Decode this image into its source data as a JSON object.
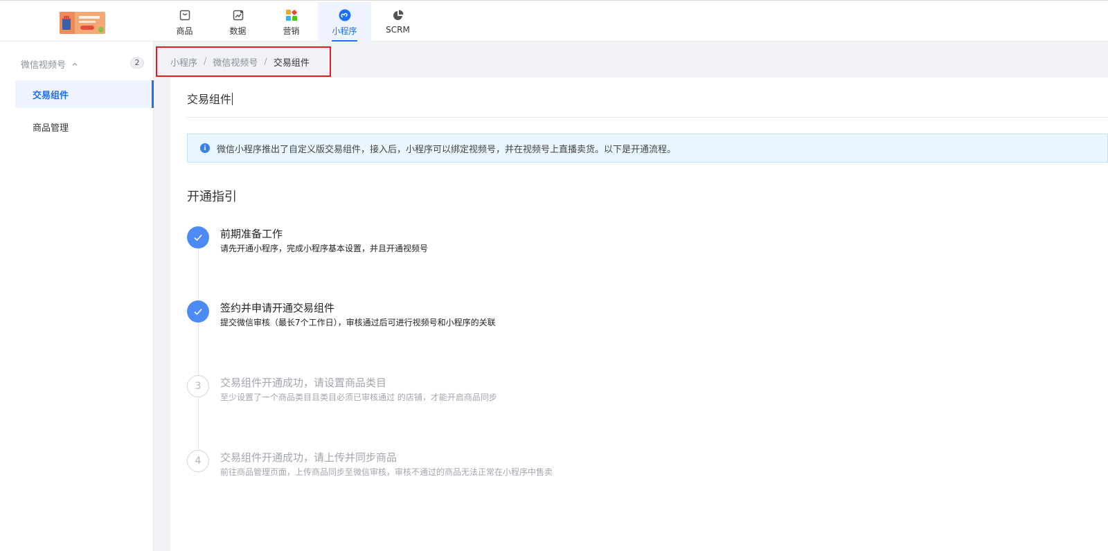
{
  "nav": [
    {
      "label": "商品",
      "icon": "bag-icon",
      "active": false
    },
    {
      "label": "数据",
      "icon": "chart-icon",
      "active": false
    },
    {
      "label": "营销",
      "icon": "apps-icon",
      "active": false
    },
    {
      "label": "小程序",
      "icon": "miniprogram-icon",
      "active": true
    },
    {
      "label": "SCRM",
      "icon": "pie-icon",
      "active": false
    }
  ],
  "sidebar": {
    "group_label": "微信视频号",
    "group_count": "2",
    "items": [
      {
        "label": "交易组件",
        "active": true
      },
      {
        "label": "商品管理",
        "active": false
      }
    ]
  },
  "breadcrumb": {
    "items": [
      "小程序",
      "微信视频号"
    ],
    "current": "交易组件"
  },
  "page": {
    "title": "交易组件",
    "alert": "微信小程序推出了自定义版交易组件，接入后，小程序可以绑定视频号，并在视频号上直播卖货。以下是开通流程。",
    "section_title": "开通指引"
  },
  "steps": [
    {
      "number": "1",
      "status": "done",
      "title": "前期准备工作",
      "desc": "请先开通小程序，完成小程序基本设置，并且开通视频号"
    },
    {
      "number": "2",
      "status": "done",
      "title": "签约并申请开通交易组件",
      "desc": "提交微信审核（最长7个工作日），审核通过后可进行视频号和小程序的关联"
    },
    {
      "number": "3",
      "status": "todo",
      "title": "交易组件开通成功，请设置商品类目",
      "desc": "至少设置了一个商品类目且类目必须已审核通过 的店铺，才能开启商品同步"
    },
    {
      "number": "4",
      "status": "todo",
      "title": "交易组件开通成功，请上传并同步商品",
      "desc": "前往商品管理页面，上传商品同步至微信审核，审核不通过的商品无法正常在小程序中售卖"
    }
  ],
  "colors": {
    "accent": "#1f6ff5",
    "step_done": "#4c8bf5",
    "highlight_border": "#e01d1d",
    "alert_bg": "#eaf6ff"
  }
}
